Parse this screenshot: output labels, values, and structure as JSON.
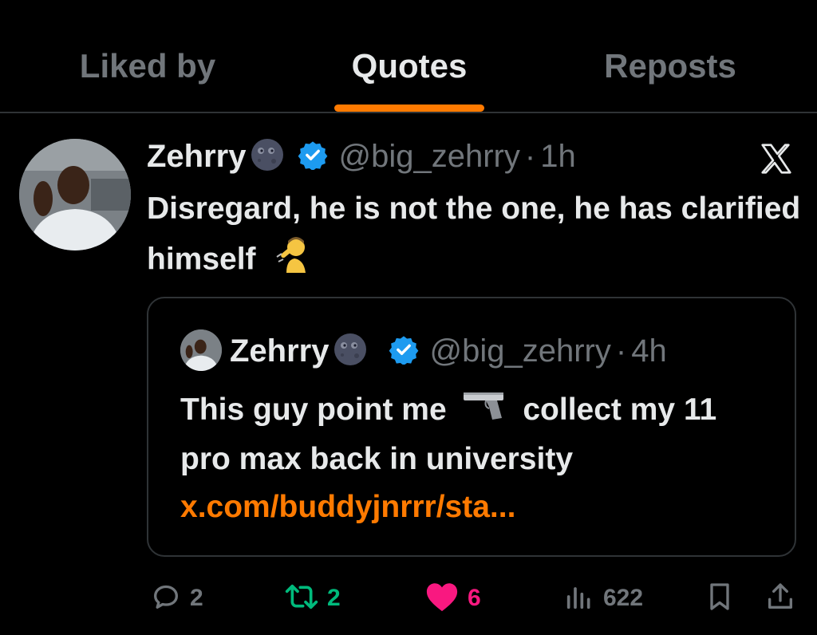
{
  "tabs": [
    {
      "label": "Liked by",
      "active": false
    },
    {
      "label": "Quotes",
      "active": true
    },
    {
      "label": "Reposts",
      "active": false
    }
  ],
  "accent_color": "#ff7a00",
  "tweet": {
    "author_name": "Zehrry",
    "author_emoji_icon": "new-moon-face-icon",
    "verified_icon": "verified-badge-icon",
    "handle": "@big_zehrry",
    "separator": "·",
    "time": "1h",
    "platform_icon": "x-logo-icon",
    "text": "Disregard, he is not the one, he has clarified himself",
    "text_emoji_icon": "person-saluting-icon"
  },
  "quoted_tweet": {
    "author_name": "Zehrry",
    "author_emoji_icon": "new-moon-face-icon",
    "handle": "@big_zehrry",
    "separator": "·",
    "time": "4h",
    "text_part1": "This guy point me",
    "text_emoji_icon": "pistol-icon",
    "text_part2": "collect my 11 pro max back in university",
    "link": "x.com/buddyjnrrr/sta..."
  },
  "actions": {
    "replies": {
      "icon": "reply-icon",
      "count": "2"
    },
    "reposts": {
      "icon": "repost-icon",
      "count": "2",
      "color": "#00ba7c"
    },
    "likes": {
      "icon": "heart-icon",
      "count": "6",
      "color": "#f91880"
    },
    "views": {
      "icon": "views-icon",
      "count": "622"
    },
    "bookmark": {
      "icon": "bookmark-icon"
    },
    "share": {
      "icon": "share-icon"
    }
  }
}
